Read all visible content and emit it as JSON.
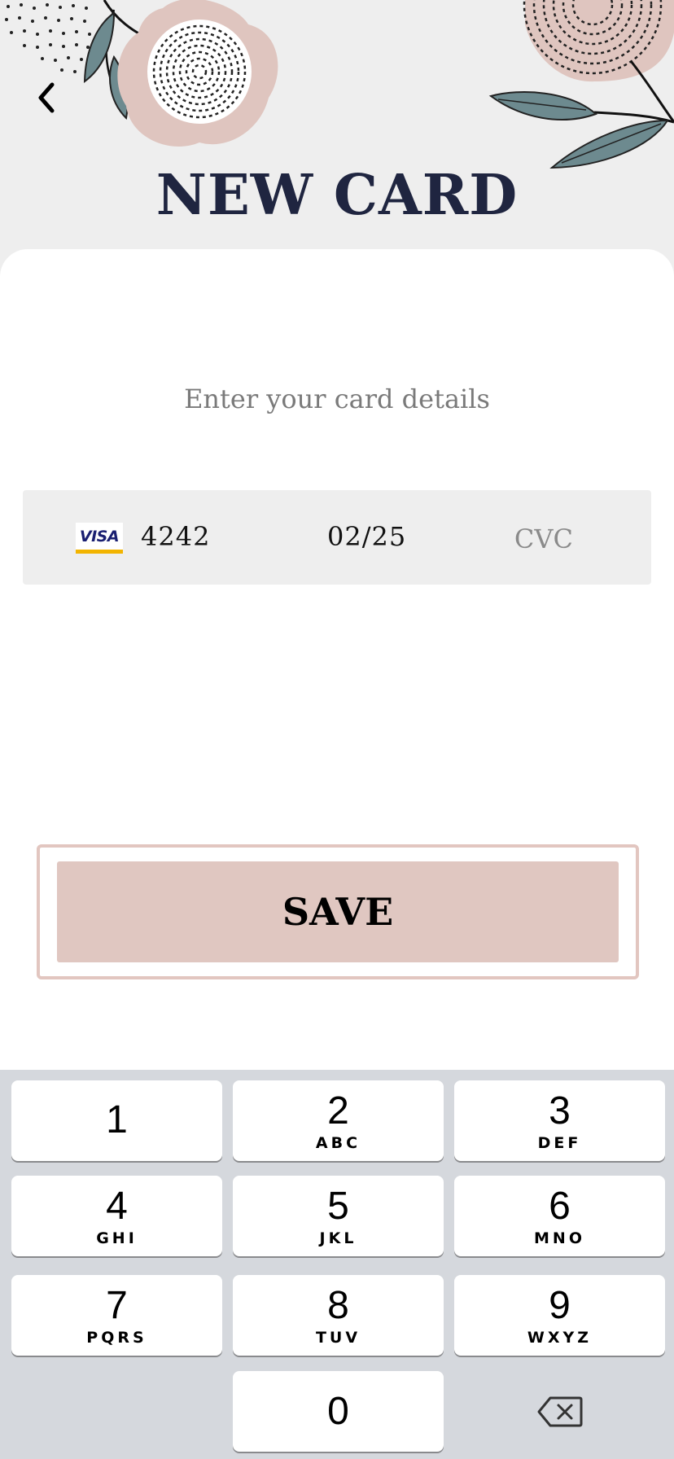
{
  "header": {
    "title": "NEW CARD",
    "back_icon": "chevron-left-icon"
  },
  "form": {
    "subtitle": "Enter your card details",
    "card": {
      "brand": "VISA",
      "number": "4242",
      "expiry": "02/25",
      "cvc_placeholder": "CVC",
      "cvc_value": ""
    },
    "save_label": "SAVE"
  },
  "keypad": {
    "keys": [
      {
        "digit": "1",
        "letters": ""
      },
      {
        "digit": "2",
        "letters": "ABC"
      },
      {
        "digit": "3",
        "letters": "DEF"
      },
      {
        "digit": "4",
        "letters": "GHI"
      },
      {
        "digit": "5",
        "letters": "JKL"
      },
      {
        "digit": "6",
        "letters": "MNO"
      },
      {
        "digit": "7",
        "letters": "PQRS"
      },
      {
        "digit": "8",
        "letters": "TUV"
      },
      {
        "digit": "9",
        "letters": "WXYZ"
      },
      {
        "digit": "0",
        "letters": ""
      }
    ],
    "backspace_icon": "backspace-icon"
  },
  "colors": {
    "title": "#1f2540",
    "accent_pink": "#e0c7c1",
    "background": "#eeeeee",
    "keypad_bg": "#d5d8dd"
  }
}
